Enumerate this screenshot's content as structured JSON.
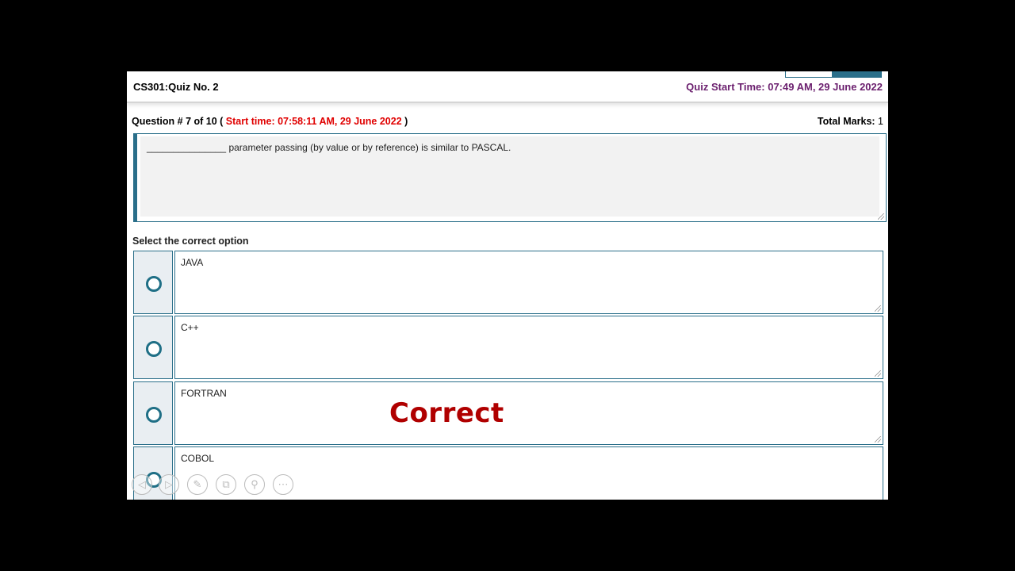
{
  "header": {
    "quiz_title": "CS301:Quiz No. 2",
    "quiz_start_time": "Quiz Start Time: 07:49 AM, 29 June 2022"
  },
  "question": {
    "number_text": "Question # 7 of 10 (",
    "start_time": "Start time: 07:58:11 AM, 29 June 2022",
    "close_paren": ")",
    "total_marks_label": "Total Marks:",
    "total_marks_value": "1",
    "text": "_______________ parameter passing (by value or by reference) is similar to PASCAL."
  },
  "select_label": "Select the correct option",
  "options": [
    {
      "label": "JAVA"
    },
    {
      "label": "C++"
    },
    {
      "label": "FORTRAN"
    },
    {
      "label": "COBOL"
    }
  ],
  "overlay": {
    "text": "Correct",
    "color": "#b00000"
  },
  "toolbar": {
    "icons": [
      "back-icon",
      "forward-icon",
      "pen-icon",
      "copy-icon",
      "zoom-icon",
      "more-icon"
    ],
    "glyphs": [
      "◁",
      "▷",
      "✎",
      "⧉",
      "⚲",
      "⋯"
    ]
  },
  "colors": {
    "accent": "#2a6f8a",
    "start_time_red": "#e00000",
    "quiz_start_purple": "#6b1f6e"
  }
}
